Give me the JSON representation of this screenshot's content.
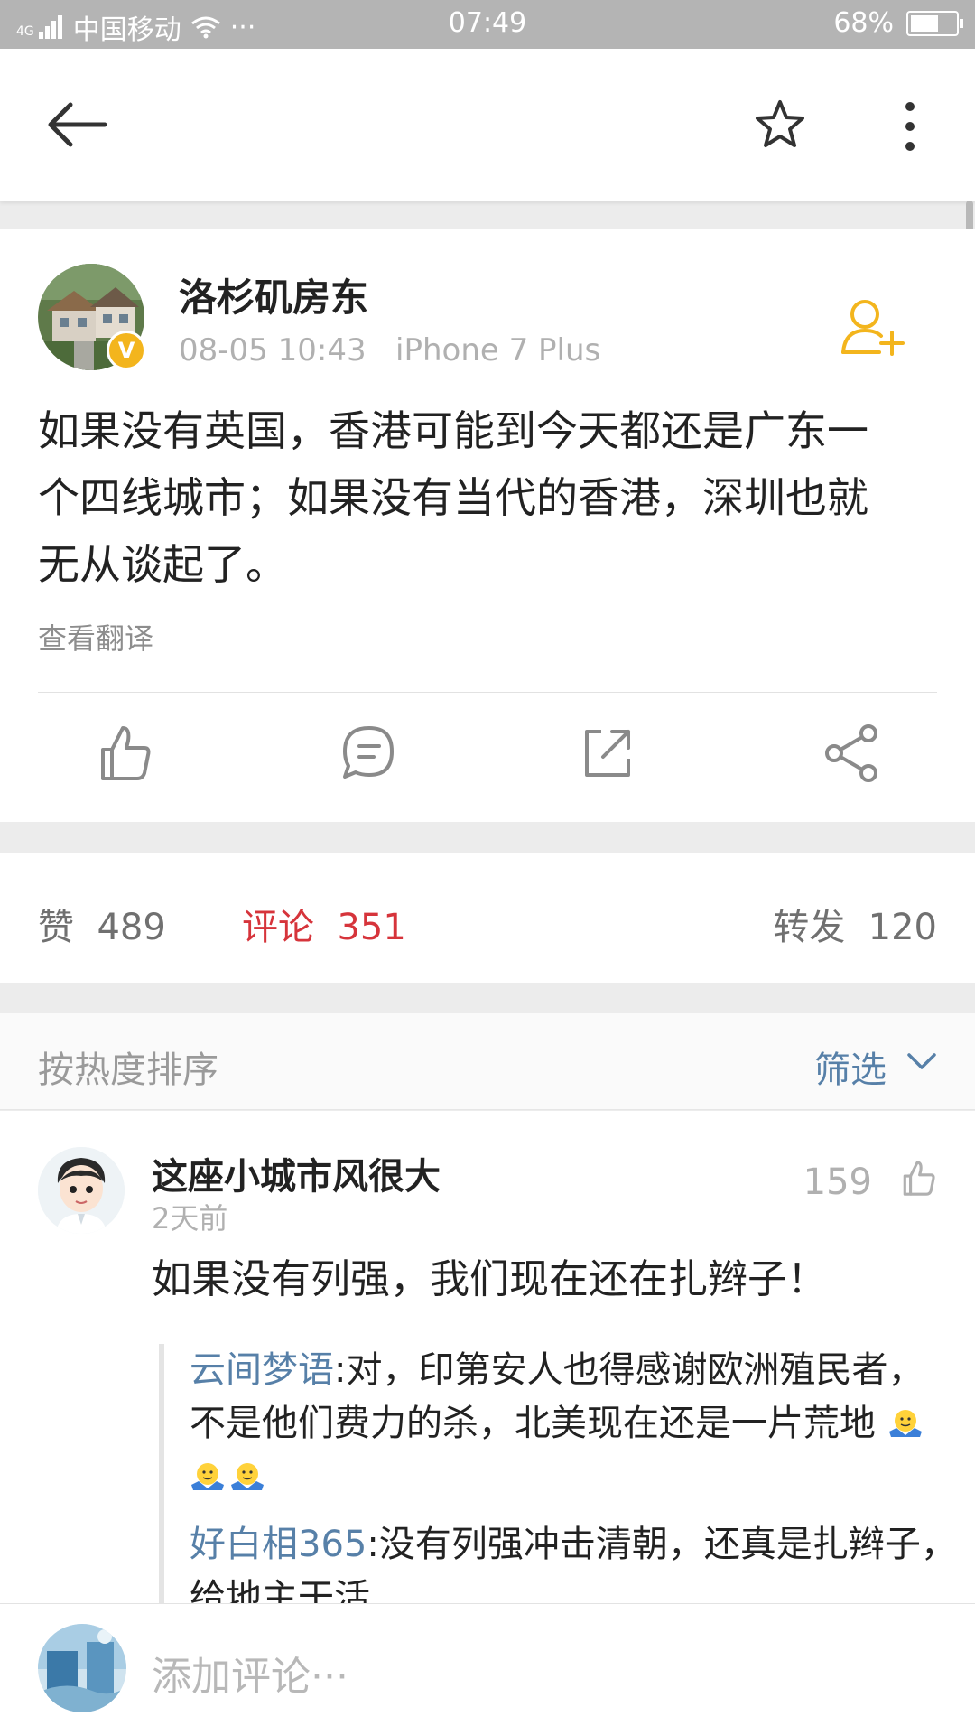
{
  "status_bar": {
    "signal": "4G",
    "carrier": "中国移动",
    "more": "···",
    "time": "07:49",
    "battery_text": "68%",
    "battery_level": 0.68
  },
  "nav": {
    "back_icon": "arrow-left-icon",
    "favorite_icon": "star-outline-icon",
    "more_icon": "vertical-dots-icon"
  },
  "post": {
    "author": "洛杉矶房东",
    "verified_mark": "V",
    "date": "08-05 10:43",
    "device": "iPhone 7 Plus",
    "text_lines": [
      "如果没有英国，香港可能到今天都还是广东一",
      "个四线城市；如果没有当代的香港，深圳也就",
      "无从谈起了。"
    ],
    "translate_label": "查看翻译",
    "action_icons": [
      "thumbs-up-icon",
      "comment-bubble-icon",
      "repost-icon",
      "share-icon"
    ]
  },
  "stats": {
    "like_label": "赞",
    "like_count": "489",
    "comment_label": "评论",
    "comment_count": "351",
    "repost_label": "转发",
    "repost_count": "120"
  },
  "sort": {
    "label": "按热度排序",
    "filter_label": "筛选"
  },
  "comment": {
    "author": "这座小城市风很大",
    "time": "2天前",
    "likes": "159",
    "text": "如果没有列强，我们现在还在扎辫子！",
    "replies": [
      {
        "author": "云间梦语",
        "text": ":对，印第安人也得感谢欧洲殖民者，不是他们费力的杀，北美现在还是一片荒地"
      },
      {
        "author": "好白相365",
        "text": ":没有列强冲击清朝，还真是扎辫子，给地主干活"
      }
    ]
  },
  "input": {
    "placeholder": "添加评论···"
  },
  "colors": {
    "accent_red": "#d6343b",
    "link_blue": "#5780a8",
    "follow_orange": "#f3b51d"
  }
}
